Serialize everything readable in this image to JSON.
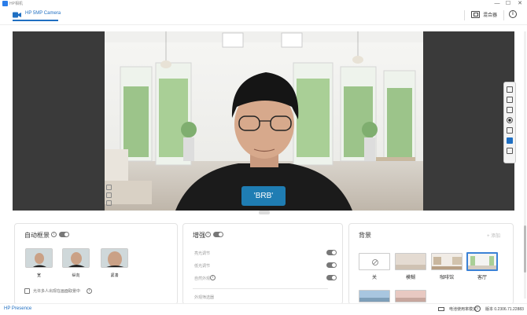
{
  "window": {
    "app_title": "HP相机",
    "minimize": "—",
    "maximize": "☐",
    "close": "✕"
  },
  "header": {
    "camera_tab": "HP 5MP Camera",
    "mixer_label": "混合器",
    "info_icon": "i"
  },
  "preview": {
    "overlay_text": "'BRB'"
  },
  "auto_frame": {
    "title": "自动框景",
    "enabled": true,
    "options": [
      {
        "label": "宽"
      },
      {
        "label": "纵向"
      },
      {
        "label": "紧凑"
      }
    ],
    "checkbox_label": "允许多人出现在画面取景中",
    "checkbox_checked": false
  },
  "enhance": {
    "title": "增强",
    "enabled": true,
    "rows": [
      {
        "label": "亮光调节",
        "enabled": true
      },
      {
        "label": "低光调节",
        "enabled": true
      },
      {
        "label": "自然外观",
        "enabled": true
      }
    ],
    "filters_label": "外观筛选器"
  },
  "background": {
    "title": "背景",
    "add_label": "+ 添加",
    "tiles": [
      {
        "label": "关",
        "selected": false
      },
      {
        "label": "模糊",
        "selected": false
      },
      {
        "label": "咖啡馆",
        "selected": false
      },
      {
        "label": "客厅",
        "selected": true
      }
    ]
  },
  "status": {
    "app_name": "HP Presence",
    "mode": "电池使用率模式",
    "version": "版本 0.2306.71.22883"
  },
  "colors": {
    "accent": "#1f6fc2",
    "brb_bg": "#1f7db3"
  }
}
